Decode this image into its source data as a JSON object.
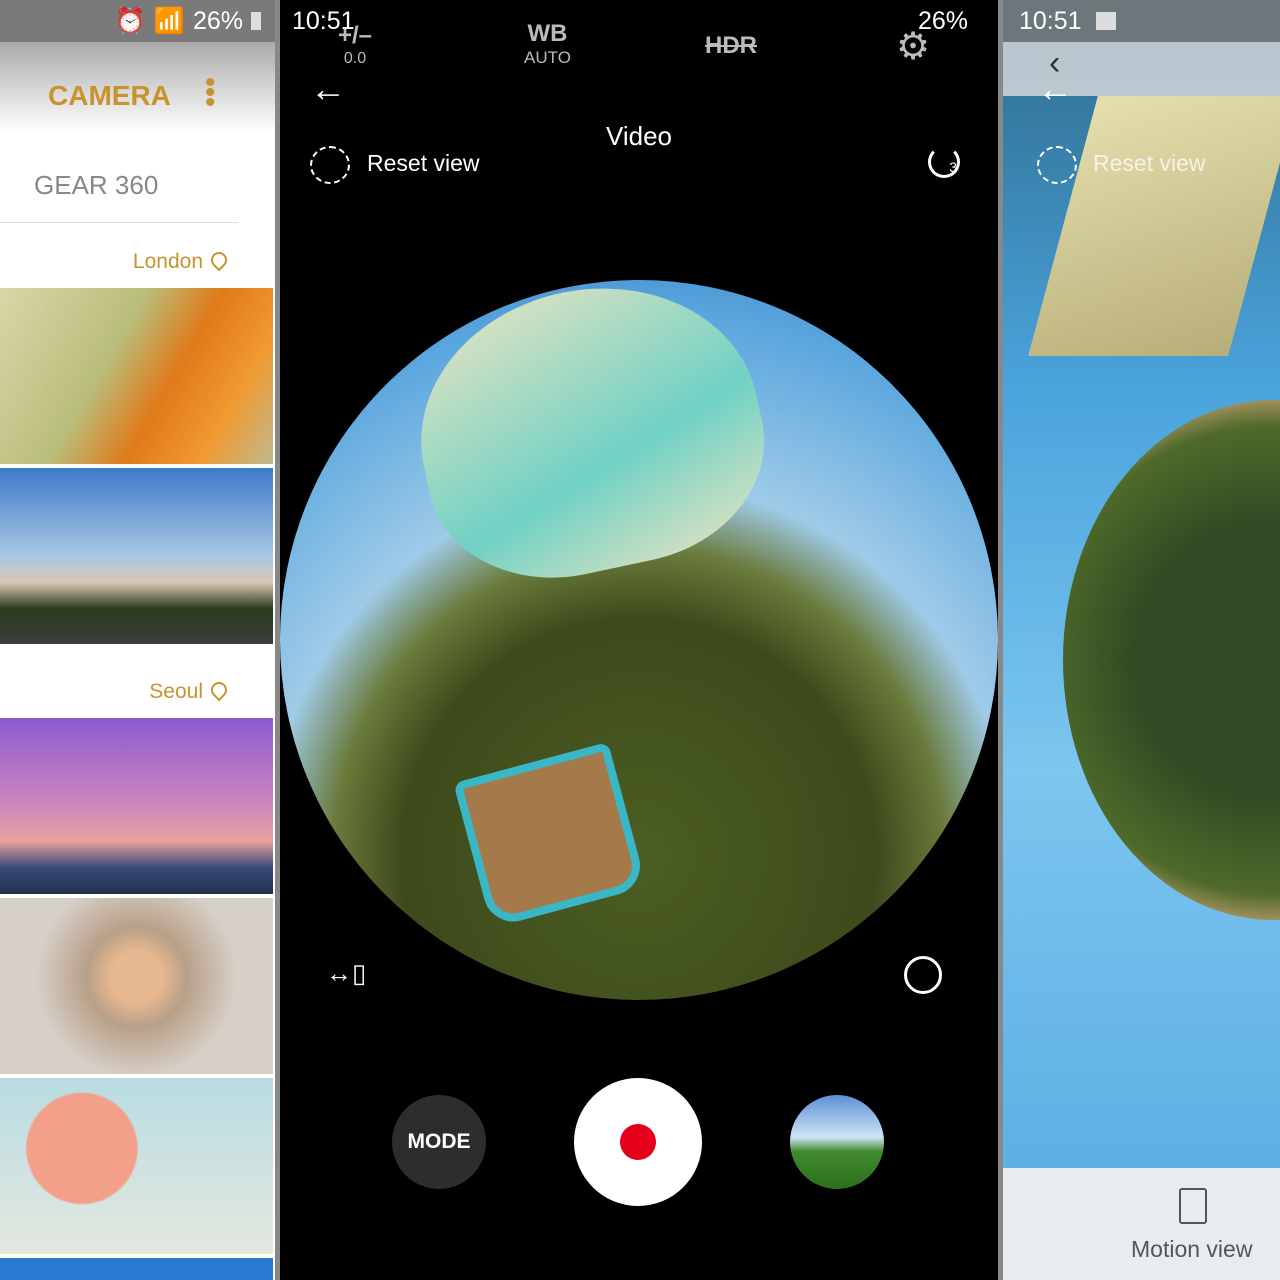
{
  "left": {
    "status": {
      "battery": "26%"
    },
    "title": "CAMERA",
    "menu_icon": "more-vert-icon",
    "device": "GEAR 360",
    "groups": [
      {
        "location": "London"
      },
      {
        "location": "Seoul"
      }
    ]
  },
  "center": {
    "status": {
      "time": "10:51",
      "battery": "26%"
    },
    "exposure": {
      "label": "+/–",
      "value": "0.0"
    },
    "wb": {
      "label": "WB",
      "value": "AUTO"
    },
    "hdr": "HDR",
    "reset_view": "Reset view",
    "mode_title": "Video",
    "timer_value": "3",
    "mode_button": "MODE",
    "record_color": "#e3001b"
  },
  "right": {
    "status": {
      "time": "10:51"
    },
    "reset_view": "Reset view",
    "motion_view": "Motion view"
  },
  "colors": {
    "accent": "#c8922e"
  }
}
